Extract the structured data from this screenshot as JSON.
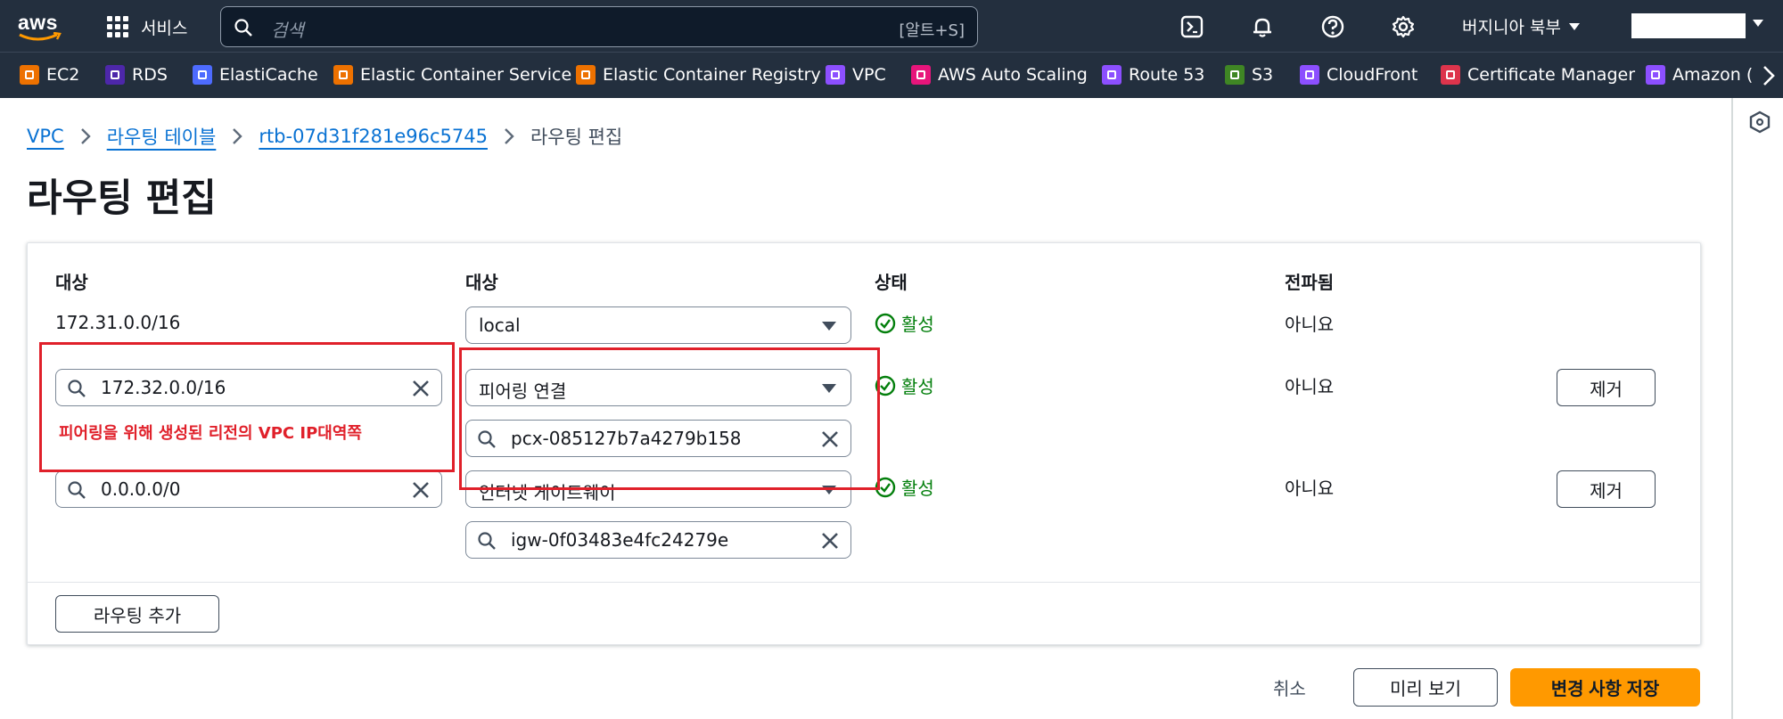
{
  "topnav": {
    "logo_text": "aws",
    "services_label": "서비스",
    "search_placeholder": "검색",
    "search_shortcut": "[알트+S]",
    "region_label": "버지니아 북부",
    "icons": [
      "cloudshell-icon",
      "bell-icon",
      "help-icon",
      "gear-icon"
    ]
  },
  "favorites": [
    {
      "label": "EC2",
      "color": "#ed7100",
      "icon": "ec2-icon"
    },
    {
      "label": "RDS",
      "color": "#4d27aa",
      "icon": "rds-icon"
    },
    {
      "label": "ElastiCache",
      "color": "#4d6bfe",
      "icon": "elasticache-icon"
    },
    {
      "label": "Elastic Container Service",
      "color": "#ed7100",
      "icon": "ecs-icon"
    },
    {
      "label": "Elastic Container Registry",
      "color": "#ed7100",
      "icon": "ecr-icon"
    },
    {
      "label": "VPC",
      "color": "#8c4fff",
      "icon": "vpc-icon"
    },
    {
      "label": "AWS Auto Scaling",
      "color": "#e7157b",
      "icon": "autoscaling-icon"
    },
    {
      "label": "Route 53",
      "color": "#8c4fff",
      "icon": "route53-icon"
    },
    {
      "label": "S3",
      "color": "#3f8624",
      "icon": "s3-icon"
    },
    {
      "label": "CloudFront",
      "color": "#8c4fff",
      "icon": "cloudfront-icon"
    },
    {
      "label": "Certificate Manager",
      "color": "#dd344c",
      "icon": "certificate-icon"
    },
    {
      "label": "Amazon (",
      "color": "#8c4fff",
      "icon": "amazon-icon"
    }
  ],
  "breadcrumb": {
    "items": [
      "VPC",
      "라우팅 테이블",
      "rtb-07d31f281e96c5745"
    ],
    "current": "라우팅 편집"
  },
  "page_title": "라우팅 편집",
  "columns": [
    "대상",
    "대상",
    "상태",
    "전파됨"
  ],
  "routes": [
    {
      "destination": "172.31.0.0/16",
      "target_type": "local",
      "target_id": "",
      "status": "활성",
      "propagated": "아니요",
      "removable": false
    },
    {
      "destination": "172.32.0.0/16",
      "target_type": "피어링 연결",
      "target_id": "pcx-085127b7a4279b158",
      "status": "활성",
      "propagated": "아니요",
      "removable": true
    },
    {
      "destination": "0.0.0.0/0",
      "target_type": "인터넷 게이트웨이",
      "target_id": "igw-0f03483e4fc24279e",
      "status": "활성",
      "propagated": "아니요",
      "removable": true
    }
  ],
  "remove_label": "제거",
  "add_route_label": "라우팅 추가",
  "annotation": "피어링을 위해 생성된 리전의 VPC IP대역쪽",
  "footer": {
    "cancel": "취소",
    "preview": "미리 보기",
    "save": "변경 사항 저장"
  },
  "colors": {
    "accent": "#0972d3",
    "primary": "#ff9900",
    "success": "#037f0c",
    "annotation": "#e0202a",
    "nav": "#232f3e"
  }
}
